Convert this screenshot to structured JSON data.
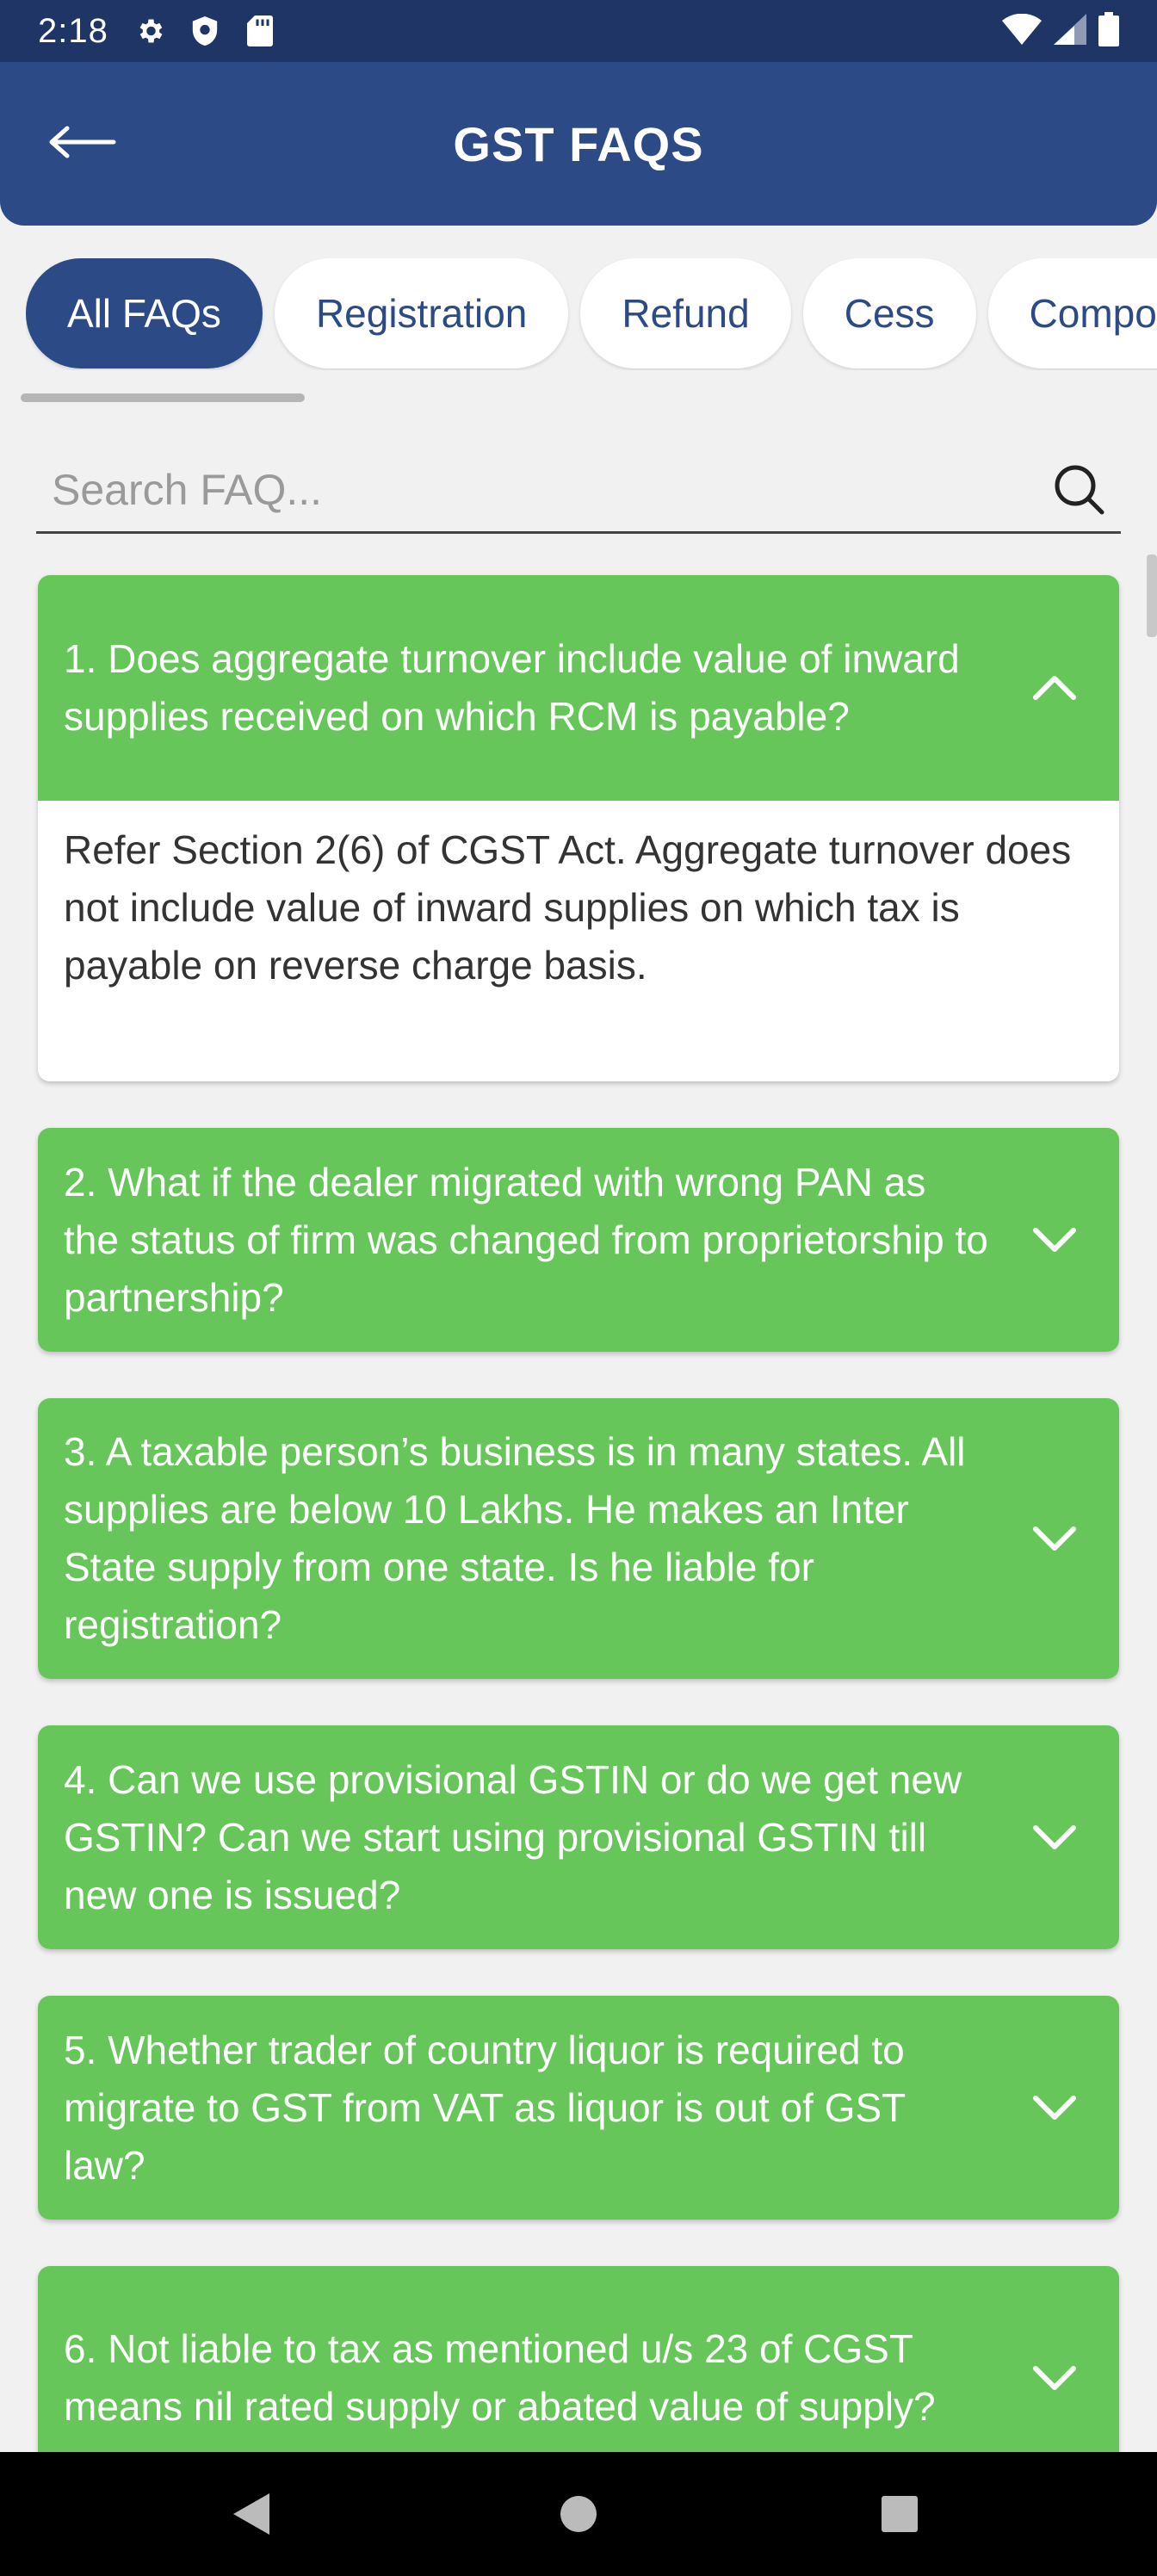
{
  "status_bar": {
    "time": "2:18",
    "icons_left": [
      "gear-icon",
      "shield-icon",
      "sd-card-icon"
    ],
    "icons_right": [
      "wifi-icon",
      "signal-icon",
      "battery-icon"
    ]
  },
  "app_bar": {
    "title": "GST FAQS",
    "back_icon": "arrow-left-icon"
  },
  "tabs": [
    {
      "label": "All FAQs",
      "active": true
    },
    {
      "label": "Registration",
      "active": false
    },
    {
      "label": "Refund",
      "active": false
    },
    {
      "label": "Cess",
      "active": false
    },
    {
      "label": "Composition",
      "active": false
    }
  ],
  "search": {
    "placeholder": "Search FAQ...",
    "value": ""
  },
  "faqs": [
    {
      "question": "1. Does aggregate turnover include value of inward supplies received on which RCM is payable?",
      "expanded": true,
      "answer": "Refer Section 2(6) of CGST Act. Aggregate turnover does not include value of inward supplies on which tax is payable on reverse charge basis."
    },
    {
      "question": "2. What if the dealer migrated with wrong PAN as the status of firm was changed from proprietorship to partnership?",
      "expanded": false
    },
    {
      "question": "3. A taxable person’s business is in many states. All supplies are below 10 Lakhs. He makes an Inter State supply from one state. Is he liable for registration?",
      "expanded": false
    },
    {
      "question": "4. Can we use provisional GSTIN or do we get new GSTIN? Can we start using provisional GSTIN till new one is issued?",
      "expanded": false
    },
    {
      "question": "5. Whether trader of country liquor is required to migrate to GST from VAT as liquor is out of GST law?",
      "expanded": false
    },
    {
      "question": "6. Not liable to tax as mentioned u/s 23 of CGST means nil rated supply or abated value of supply?",
      "expanded": false
    }
  ],
  "colors": {
    "primary": "#2c4a86",
    "status_bar": "#1f3566",
    "faq_header": "#66c659",
    "background": "#f1f1f1"
  }
}
